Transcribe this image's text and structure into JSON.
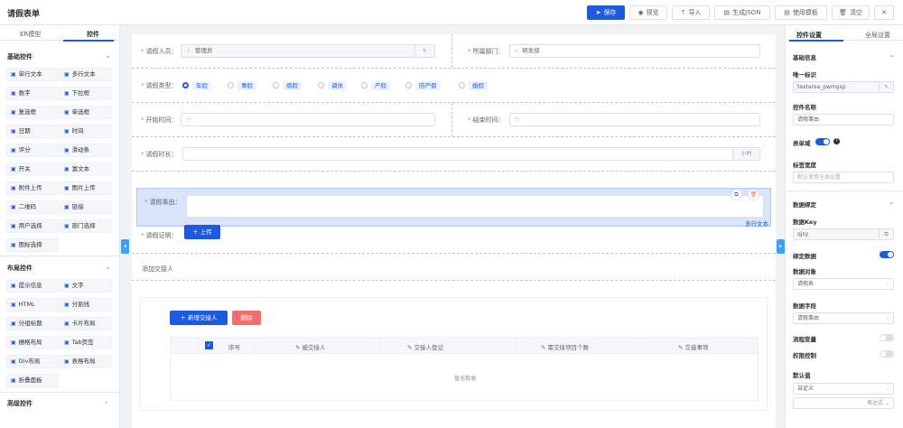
{
  "app_title": "请假表单",
  "toolbar": {
    "save": "保存",
    "preview": "预览",
    "import": "导入",
    "generate_json": "生成JSON",
    "use_template": "使用模板",
    "clear": "清空",
    "close": "✕"
  },
  "left": {
    "tabs": [
      "ER模型",
      "控件"
    ],
    "basic_title": "基础控件",
    "basic_items": [
      "单行文本",
      "多行文本",
      "数字",
      "下拉框",
      "复选框",
      "单选框",
      "日期",
      "时间",
      "评分",
      "滑动条",
      "开关",
      "富文本",
      "附件上传",
      "图片上传",
      "二维码",
      "链接",
      "用户选择",
      "部门选择",
      "图标选择"
    ],
    "layout_title": "布局控件",
    "layout_items": [
      "提示信息",
      "文字",
      "HTML",
      "分割线",
      "分组标题",
      "卡片布局",
      "栅格布局",
      "Tab页签",
      "Div布局",
      "表格布局",
      "折叠面板"
    ],
    "advanced_title": "高级控件"
  },
  "form": {
    "applicant_label": "请假人员：",
    "applicant_value": "管理员",
    "department_label": "所属部门：",
    "department_value": "研发部",
    "leave_type_label": "请假类型：",
    "leave_types": [
      "年假",
      "事假",
      "病假",
      "调休",
      "产假",
      "陪产假",
      "婚假"
    ],
    "leave_type_selected": "年假",
    "start_label": "开始时间：",
    "end_label": "结束时间：",
    "duration_label": "请假时长：",
    "duration_suffix": "小时",
    "reason_label": "请假事由：",
    "reason_type_tag": "多行文本",
    "proof_label": "请假证明：",
    "upload_label": "上传",
    "handover_title": "添加交接人",
    "add_handover": "新增交接人",
    "delete": "删除",
    "table_headers": [
      "序号",
      "被交接人",
      "交接人登记",
      "需交接项目个数",
      "交接事项"
    ],
    "empty_text": "暂无数据"
  },
  "right": {
    "tabs": [
      "控件设置",
      "全局设置"
    ],
    "basic_info": "基础信息",
    "unique_id_label": "唯一标识",
    "unique_id_value": "textarea_pwmgsp",
    "control_name_label": "控件名称",
    "control_name_value": "请假事由",
    "required_label": "表单域",
    "required_on": true,
    "label_width_label": "标签宽度",
    "label_width_placeholder": "默认使用全局设置",
    "data_binding": "数据绑定",
    "data_key_label": "数据Key",
    "data_key_value": "qjsy",
    "bind_data_label": "绑定数据",
    "bind_data_on": true,
    "data_object_label": "数据对象",
    "data_object_value": "请假表",
    "data_field_label": "数据字段",
    "data_field_value": "请假事由",
    "flow_var_label": "流程变量",
    "flow_var_on": false,
    "perm_label": "权限控制",
    "perm_on": false,
    "default_label": "默认值",
    "default_value": "自定义",
    "expr_label": "表达式"
  },
  "colors": {
    "primary": "#1c5be0",
    "danger": "#f56c6c",
    "selected_bg": "#d9e4fb"
  }
}
